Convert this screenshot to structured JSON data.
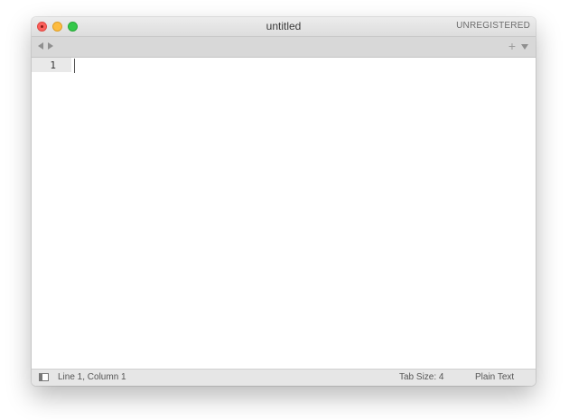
{
  "window": {
    "title": "untitled",
    "registration": "UNREGISTERED"
  },
  "tabbar": {
    "back_icon": "chevron-left-icon",
    "forward_icon": "chevron-right-icon",
    "new_tab_icon": "plus-icon",
    "new_tab_label": "+",
    "tab_menu_icon": "triangle-down-icon"
  },
  "editor": {
    "lines": [
      {
        "number": "1",
        "text": ""
      }
    ]
  },
  "statusbar": {
    "sidebar_icon": "sidebar-toggle-icon",
    "position": "Line 1, Column 1",
    "tab_size": "Tab Size: 4",
    "syntax": "Plain Text"
  },
  "colors": {
    "close": "#fc605c",
    "minimize": "#fdbc40",
    "zoom": "#34c84a"
  }
}
